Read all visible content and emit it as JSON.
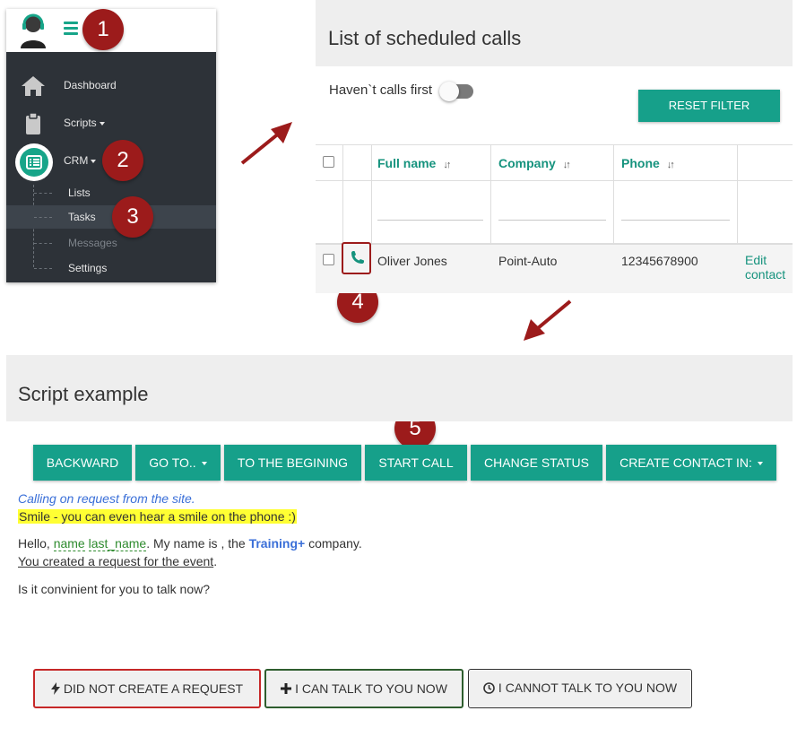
{
  "sidebar": {
    "items": [
      {
        "label": "Dashboard",
        "icon": "home-icon"
      },
      {
        "label": "Scripts",
        "icon": "clipboard-icon"
      },
      {
        "label": "CRM",
        "icon": "list-icon"
      }
    ],
    "subitems": [
      {
        "label": "Lists"
      },
      {
        "label": "Tasks"
      },
      {
        "label": "Messages"
      },
      {
        "label": "Settings"
      }
    ]
  },
  "badges": [
    "1",
    "2",
    "3",
    "4",
    "5"
  ],
  "calls": {
    "title": "List of scheduled calls",
    "filter_label": "Haven`t calls first",
    "reset_label": "RESET FILTER",
    "columns": [
      "Full name",
      "Company",
      "Phone"
    ],
    "sort_glyph": "↓↑",
    "row": {
      "full_name": "Oliver Jones",
      "company": "Point-Auto",
      "phone": "12345678900",
      "action_1": "Edit",
      "action_2": "contact"
    }
  },
  "script": {
    "title": "Script example",
    "toolbar": [
      "BACKWARD",
      "GO TO..",
      "TO THE BEGINING",
      "START CALL",
      "CHANGE STATUS",
      "CREATE CONTACT IN:"
    ],
    "note": "Calling on request from the site.",
    "highlight": "Smile - you can even hear a smile on the phone :)",
    "greeting_start": "Hello, ",
    "var_name": "name",
    "var_last_name": "last_name",
    "greeting_mid": ". My name is , the ",
    "brand": "Training+",
    "greeting_end": " company.",
    "request_text": "You created a request for the event",
    "request_end": ".",
    "question": "Is it convinient for you to talk now?",
    "answers": [
      "DID NOT CREATE A REQUEST",
      "I CAN TALK TO YOU NOW",
      "I CANNOT TALK TO YOU NOW"
    ]
  },
  "colors": {
    "accent": "#16a08a",
    "badge": "#9c1b1b",
    "sidebar": "#2d3238"
  }
}
